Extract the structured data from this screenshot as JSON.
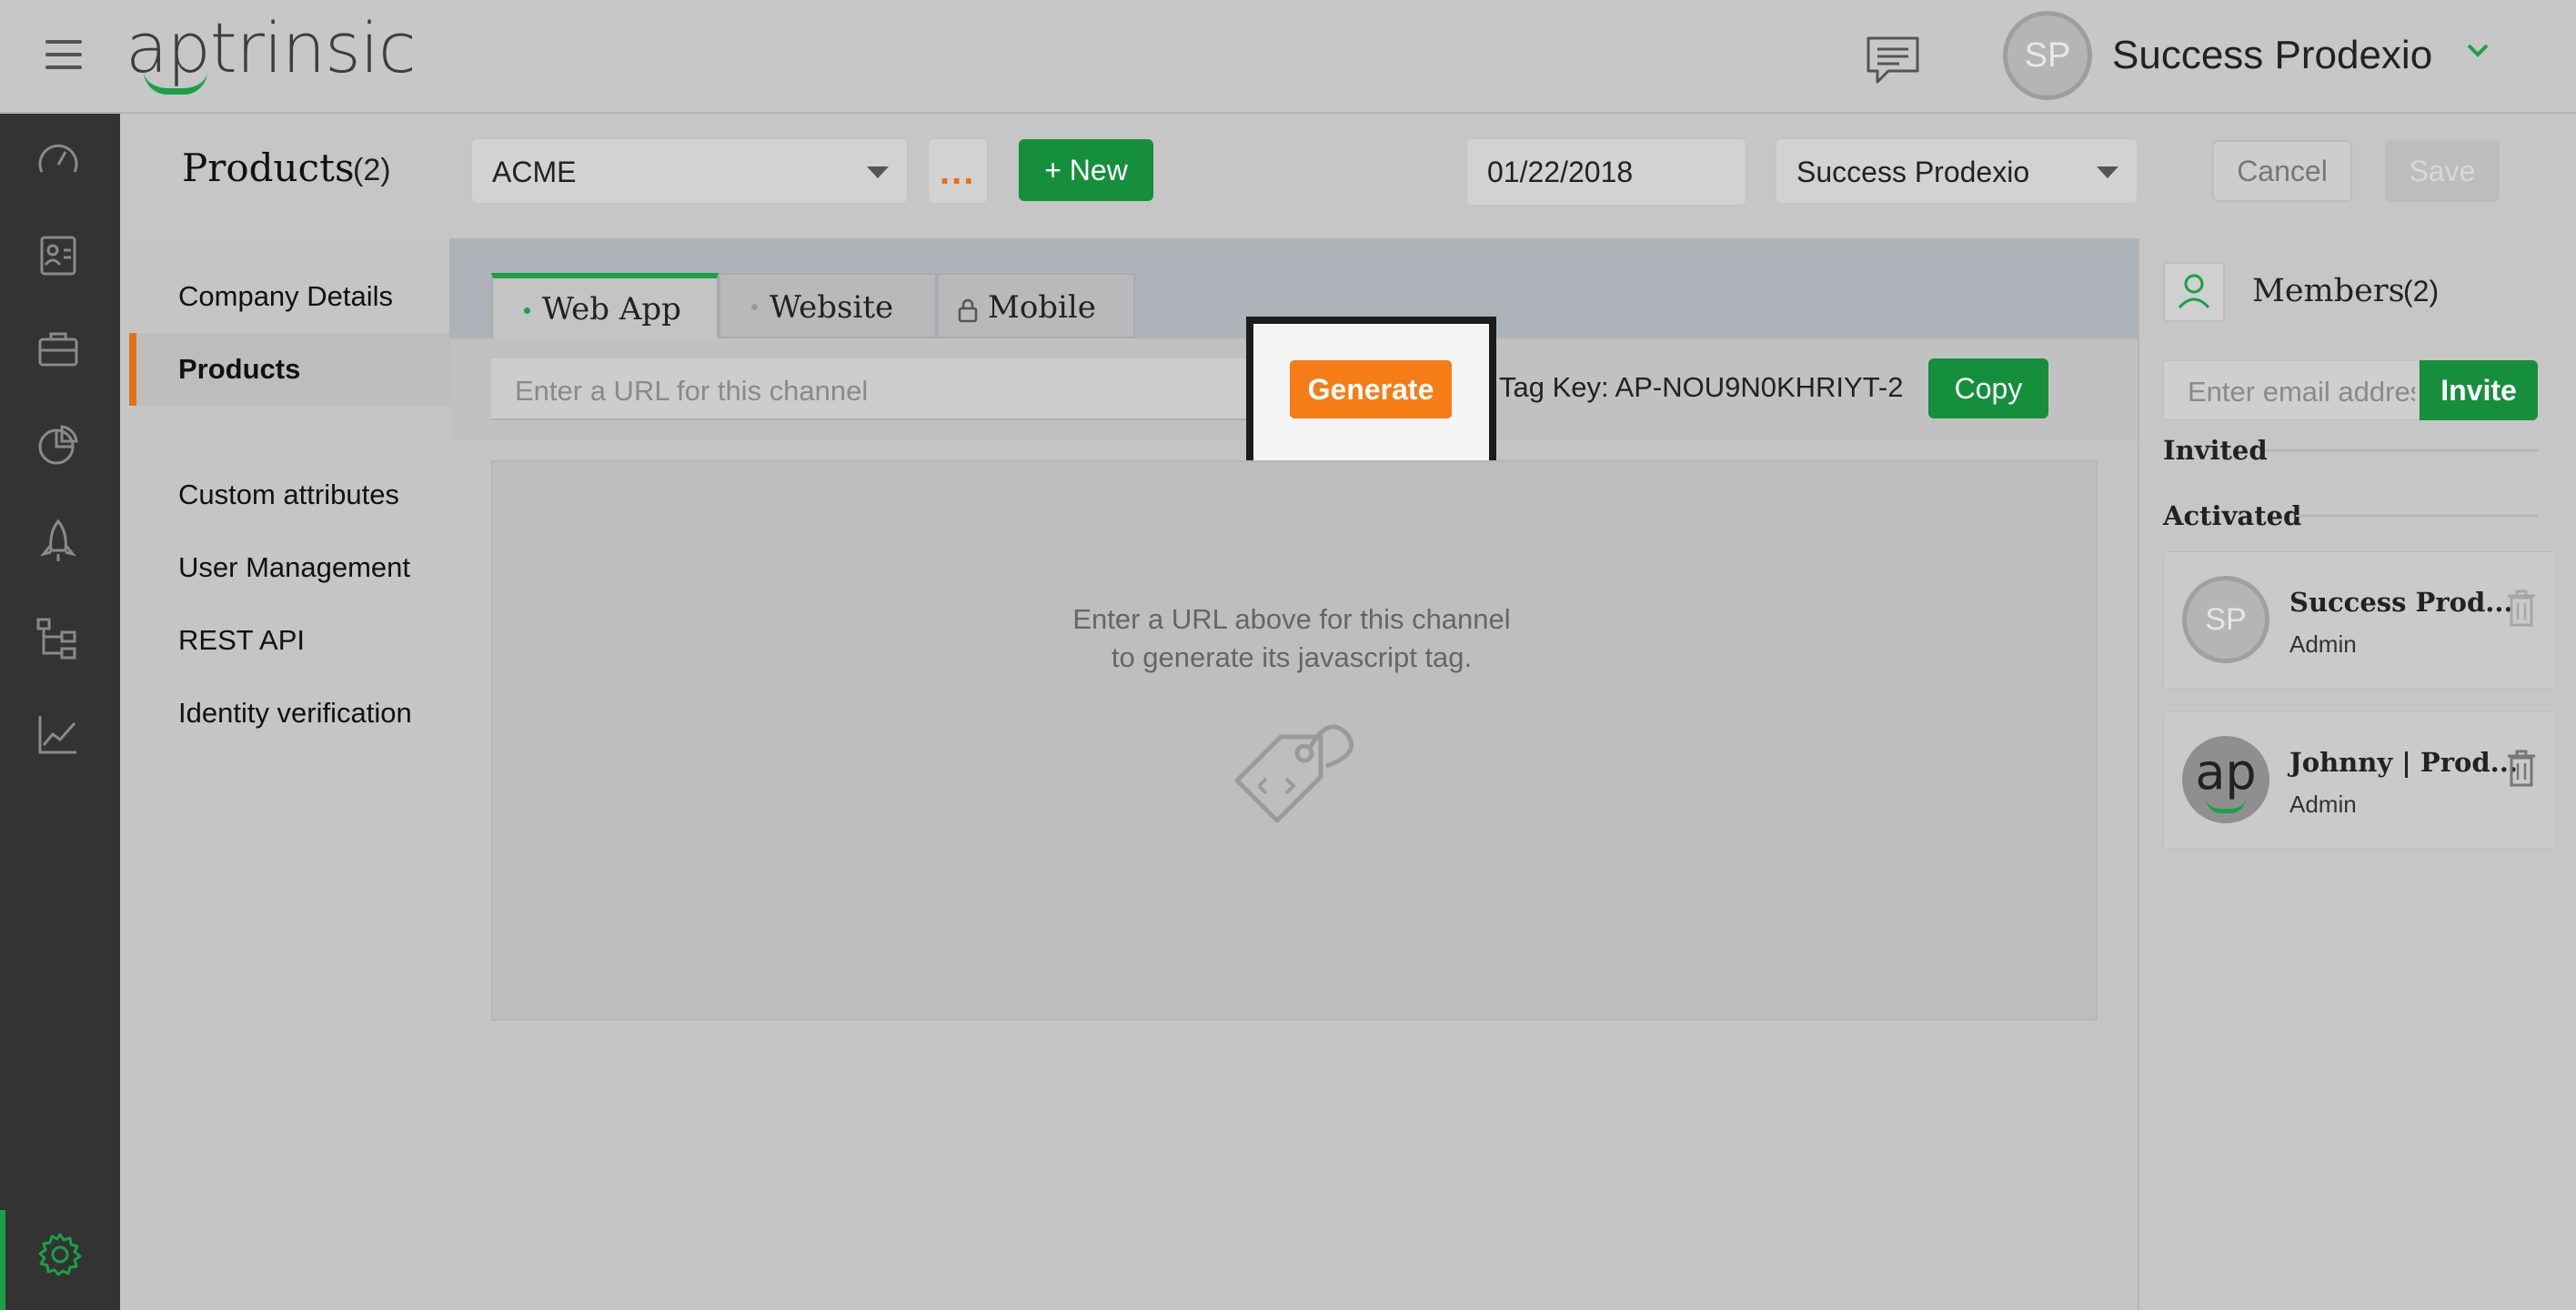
{
  "app": {
    "logo_text": "aptrinsic"
  },
  "header": {
    "user": {
      "initials": "SP",
      "name": "Success Prodexio"
    }
  },
  "sidenav": {
    "icons": [
      "dashboard-icon",
      "users-icon",
      "accounts-icon",
      "reports-icon",
      "engagements-icon",
      "journey-icon",
      "analytics-icon",
      "settings-icon"
    ],
    "active": "settings-icon",
    "accent_color": "#1aa048"
  },
  "toolbar": {
    "title": "Products",
    "count": "(2)",
    "product_select": "ACME",
    "more_label": "...",
    "new_label": "+ New",
    "date": "01/22/2018",
    "owner_select": "Success Prodexio",
    "cancel_label": "Cancel",
    "save_label": "Save"
  },
  "settings_nav": {
    "items": [
      {
        "label": "Company Details"
      },
      {
        "label": "Products",
        "active": true
      },
      {
        "label": "Custom attributes"
      },
      {
        "label": "User Management"
      },
      {
        "label": "REST API"
      },
      {
        "label": "Identity verification"
      }
    ]
  },
  "channels": {
    "tabs": [
      {
        "label": "Web App",
        "active": true
      },
      {
        "label": "Website"
      },
      {
        "label": "Mobile",
        "locked": true
      }
    ],
    "url_placeholder": "Enter a URL for this channel",
    "generate_label": "Generate",
    "tag_key": "Tag Key: AP-NOU9N0KHRIYT-2",
    "copy_label": "Copy",
    "empty_line1": "Enter a URL above for this channel",
    "empty_line2": "to generate its javascript tag."
  },
  "members": {
    "title": "Members",
    "count": "(2)",
    "email_placeholder": "Enter email address",
    "invite_label": "Invite",
    "invited_label": "Invited",
    "activated_label": "Activated",
    "list": [
      {
        "initials": "SP",
        "name": "Success Prod...",
        "role": "Admin"
      },
      {
        "initials": "ap",
        "name": "Johnny | Prod...",
        "role": "Admin"
      }
    ]
  },
  "colors": {
    "primary_green": "#158f3c",
    "accent_orange": "#f57c16",
    "sidenav_bg": "#333333"
  }
}
